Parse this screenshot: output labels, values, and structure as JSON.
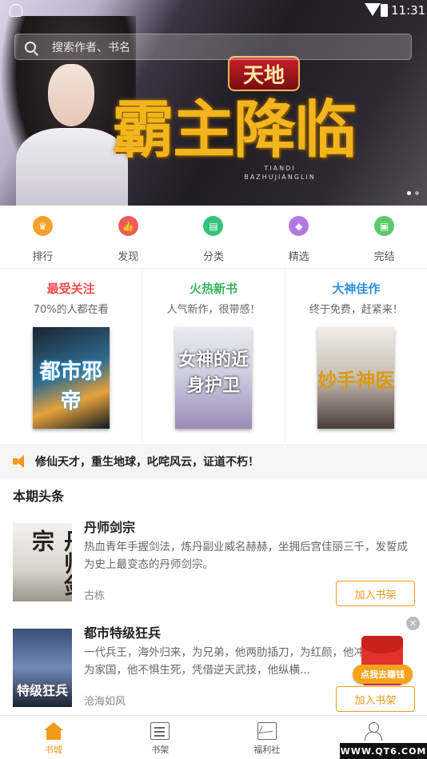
{
  "status_bar": {
    "time": "11:31"
  },
  "search": {
    "placeholder": "搜索作者、书名"
  },
  "banner": {
    "badge_text": "天地",
    "title_text": "霸主降临",
    "pinyin_line1": "TIANDI",
    "pinyin_line2": "BAZHUJIANGLIN",
    "slide_count": 2,
    "active_slide": 1
  },
  "nav": [
    {
      "label": "排行",
      "color": "#f4a12a",
      "icon": "trophy-icon"
    },
    {
      "label": "发现",
      "color": "#f05a5a",
      "icon": "thumbs-up-icon"
    },
    {
      "label": "分类",
      "color": "#36c27a",
      "icon": "book-category-icon"
    },
    {
      "label": "精选",
      "color": "#b179e0",
      "icon": "diamond-icon"
    },
    {
      "label": "完结",
      "color": "#5cc96a",
      "icon": "book-finished-icon"
    }
  ],
  "featured": [
    {
      "title": "最受关注",
      "subtitle": "70%的人都在看",
      "color": "#ee4d4d",
      "cover_text": "都市邪帝"
    },
    {
      "title": "火热新书",
      "subtitle": "人气新作，很带感！",
      "color": "#3bb55c",
      "cover_text": "女神的近身护卫"
    },
    {
      "title": "大神佳作",
      "subtitle": "终于免费，赶紧来！",
      "color": "#2e8fe0",
      "cover_text": "妙手神医"
    }
  ],
  "notice": {
    "text": "修仙天才，重生地球，叱咤风云，证道不朽！"
  },
  "section": {
    "title": "本期头条"
  },
  "books": [
    {
      "title": "丹师剑宗",
      "description": "热血青年手握剑法，炼丹副业威名赫赫，坐拥后宫佳丽三千，发誓成为史上最变态的丹师剑宗。",
      "author": "古栋",
      "button": "加入书架",
      "cover_text": "丹师剑宗"
    },
    {
      "title": "都市特级狂兵",
      "description": "一代兵王，海外归来，为兄弟，他两肋插刀，为红颜，他冲冠一怒，为家国，他不惧生死，凭借逆天武技，他纵横...",
      "author": "沧海如风",
      "button": "加入书架",
      "cover_text": "特级狂兵"
    }
  ],
  "promo": {
    "label": "点我去赚钱",
    "close": "✕"
  },
  "tabs": [
    {
      "label": "书城",
      "icon": "home-icon",
      "active": true
    },
    {
      "label": "书架",
      "icon": "bookshelf-icon",
      "active": false
    },
    {
      "label": "福利社",
      "icon": "welfare-icon",
      "active": false
    },
    {
      "label": "我的",
      "icon": "user-icon",
      "active": false
    }
  ],
  "watermark": {
    "text": "WWW.QT6.COM"
  },
  "colors": {
    "accent": "#f19a1b"
  }
}
